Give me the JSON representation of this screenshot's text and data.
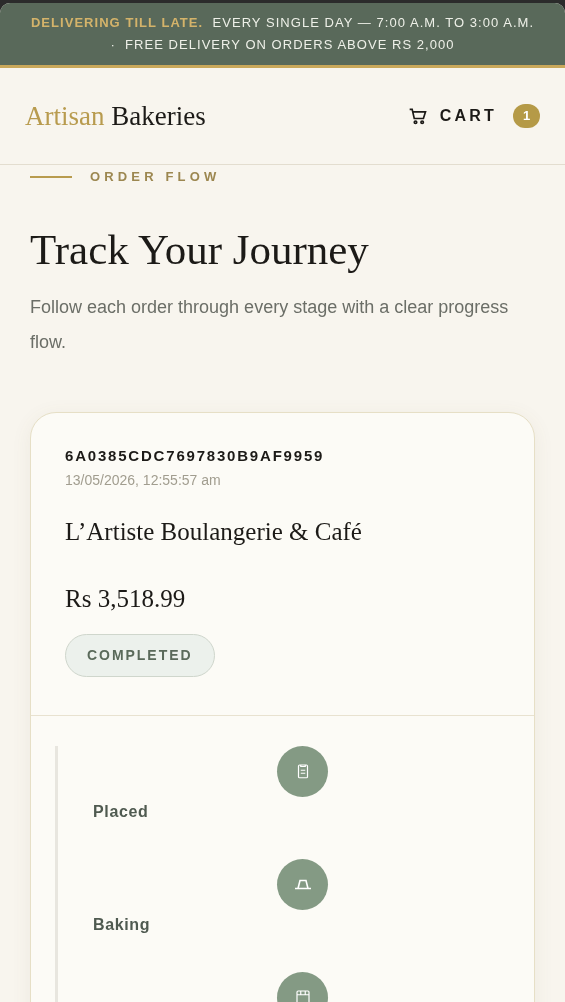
{
  "announcement": {
    "text": "**DELIVERING TILL LATE.**  EVERY SINGLE DAY — 7:00 A.M. TO 3:00 A.M.  ·  FREE DELIVERY ON ORDERS ABOVE RS 2,000"
  },
  "header": {
    "brand_first": "Artisan",
    "brand_second": "Bakeries",
    "cart_label": "CART",
    "cart_count": "1"
  },
  "section": {
    "eyebrow": "ORDER FLOW",
    "title": "Track Your Journey",
    "description": "Follow each order through every stage with a clear progress flow."
  },
  "order": {
    "id": "6A0385CDC7697830B9AF9959",
    "date": "13/05/2026, 12:55:57 am",
    "shop": "L’Artiste Boulangerie & Café",
    "total": "Rs 3,518.99",
    "status": "COMPLETED",
    "steps": [
      {
        "kind": "clipboard",
        "label": "Placed"
      },
      {
        "kind": "bake",
        "label": "Baking"
      },
      {
        "kind": "oven"
      }
    ]
  }
}
